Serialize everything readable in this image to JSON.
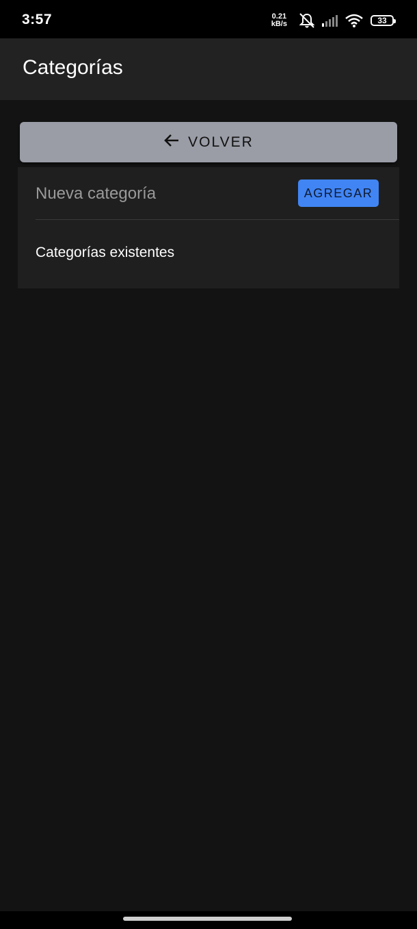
{
  "status_bar": {
    "time": "3:57",
    "net_speed_value": "0.21",
    "net_speed_unit": "kB/s",
    "icons": [
      "mute-notifications-icon",
      "signal-icon",
      "wifi-icon",
      "battery-icon"
    ],
    "battery_level": "33"
  },
  "app_bar": {
    "title": "Categorías"
  },
  "back_button": {
    "icon": "arrow-left-icon",
    "label": "VOLVER"
  },
  "new_category": {
    "value": "",
    "placeholder": "Nueva categoría",
    "add_label": "AGREGAR"
  },
  "existing": {
    "label": "Categorías existentes"
  },
  "colors": {
    "background": "#131313",
    "app_bar": "#222222",
    "back_button": "#9a9da6",
    "card": "#1f1f1f",
    "accent": "#4185f4"
  }
}
